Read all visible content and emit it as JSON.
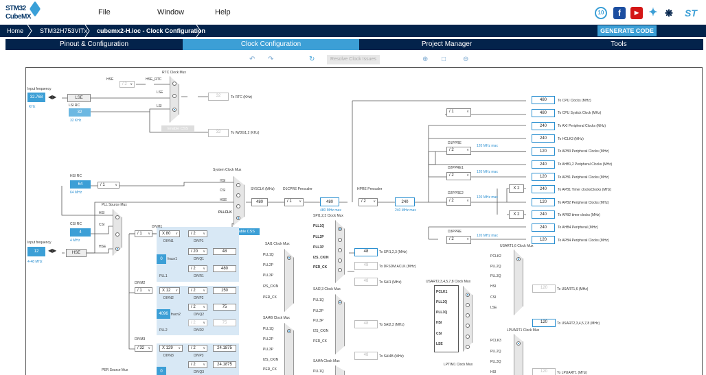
{
  "app": {
    "logo_line1": "STM32",
    "logo_line2": "CubeMX"
  },
  "menu": {
    "file": "File",
    "window": "Window",
    "help": "Help"
  },
  "breadcrumb": {
    "home": "Home",
    "device": "STM32H753VITx",
    "file": "cubemx2-H.ioc - Clock Configuration"
  },
  "actions": {
    "generate": "GENERATE CODE"
  },
  "tabs": {
    "pinout": "Pinout & Configuration",
    "clock": "Clock Configuration",
    "project": "Project Manager",
    "tools": "Tools"
  },
  "toolbar": {
    "resolve": "Resolve Clock Issues"
  },
  "colors": {
    "navy": "#03234b",
    "accent": "#3c9fd6"
  },
  "icons": [
    "undo-icon",
    "redo-icon",
    "refresh-icon",
    "zoom-in-icon",
    "fit-icon",
    "zoom-out-icon",
    "social-icon",
    "facebook-icon",
    "youtube-icon",
    "twitter-icon",
    "network-icon",
    "st-logo-icon"
  ],
  "clock": {
    "rtc_mux": "RTC Clock Mux",
    "hse": "HSE",
    "hse_rtc": "HSE_RTC",
    "lse": "LSE",
    "lsi": "LSI",
    "div2": "/ 2",
    "div1": "/ 1",
    "input_freq": "Input frequency",
    "lse_value": "32.768",
    "khz": "KHz",
    "lsi_rc": "LSI RC",
    "lsi_value": "32",
    "lsi_khz": "32 KHz",
    "rtc_val": "32",
    "to_rtc": "To RTC (KHz)",
    "enable_css": "Enable CSS",
    "iwdg_val": "32",
    "to_iwdg": "To IWDG1,2 (KHz)",
    "hsi_rc": "HSI RC",
    "hsi_value": "64",
    "hsi_mhz": "64 MHz",
    "csi_rc": "CSI RC",
    "csi_value": "4",
    "csi_mhz": "4 MHz",
    "hse_value": "12",
    "hse_range": "4-48 MHz",
    "pll_source_mux": "PLL Source Mux",
    "hsi": "HSI",
    "csi": "CSI",
    "system_clock_mux": "System Clock Mux",
    "pllclk": "PLLCLK",
    "sysclk_label": "SYSCLK (MHz)",
    "sysclk": "480",
    "d1cpre_label": "D1CPRE Prescaler",
    "d1cpre": "/ 1",
    "d1cpre_out": "480",
    "max480": "480 MHz max",
    "hpre_label": "HPRE Prescaler",
    "hpre": "/ 2",
    "hpre_out": "240",
    "max240": "240 MHz max",
    "divm1": "DIVM1",
    "divm1_val": "/ 1",
    "mult1": "X 80",
    "divp1_sel": "/ 2",
    "divp1": "DIVP1",
    "divn1": "DIVN1",
    "divq1_sel": "/ 20",
    "divq1_out": "48",
    "divq1": "DIVQ1",
    "fracn1": "fracn1",
    "frac1_val": "0",
    "divr1_sel": "/ 2",
    "divr1_out": "480",
    "divr1": "DIVR1",
    "pll1": "PLL1",
    "divm2": "DIVM2",
    "divm2_val": "/ 1",
    "mult2": "X 12",
    "divp2_sel": "/ 2",
    "divp2_out": "150",
    "divp2": "DIVP2",
    "divn2": "DIVN2",
    "divq2_sel": "/ 2",
    "divq2_out": "75",
    "divq2": "DIVQ2",
    "fracn2": "fracn2",
    "frac2_val": "4096",
    "divr2_sel": "/ 2",
    "divr2_out": "75",
    "divr2": "DIVR2",
    "pll2": "PLL2",
    "divm3": "DIVM3",
    "divm3_val": "/ 32",
    "mult3": "X 129",
    "divp3_sel": "/ 2",
    "divp3_out": "24.1875",
    "divp3": "DIVP3",
    "divn3": "DIVN3",
    "divq3_sel": "/ 2",
    "divq3_out": "24.1875",
    "divq3": "DIVQ3",
    "frac3_val": "0",
    "per_source_mux": "PER Source Mux",
    "spi123_mux": "SPI1,2,3 Clock Mux",
    "pll1q": "PLL1Q",
    "pll2p": "PLL2P",
    "pll3p": "PLL3P",
    "i2s_ckin": "I2S_CKIN",
    "per_ck": "PER_CK",
    "spi_out": "48",
    "to_spi": "To SPI1,2,3 (MHz)",
    "dfsdm_out": "48",
    "to_dfsdm": "To DFSDM ACLK (MHz)",
    "sai1_mux": "SAI1 Clock Mux",
    "sai1_out": "48",
    "to_sai1": "To SAI1 (MHz)",
    "sai23_mux": "SAI2,3 Clock Mux",
    "sai23_out": "48",
    "to_sai23": "To SAI2,3 (MHz)",
    "sai4b_mux": "SAI4B Clock Mux",
    "sai4b_out": "48",
    "to_sai4b": "To SAI4B (MHz)",
    "sai4a_mux": "SAI4A Clock Mux",
    "pll1q_l": "PLL1Q",
    "pll2p_l": "PLL2P",
    "pll3p_l": "PLL3P",
    "usart_mux": "USART2,3,4,5,7,8 Clock Mux",
    "pclk1": "PCLK1",
    "pll2q": "PLL2Q",
    "pll3q": "PLL3Q",
    "lse_l": "LSE",
    "usart_out": "120",
    "to_usart": "To USART2,3,4,5,7,8 (MHz)",
    "usart16_mux": "USART1,6 Clock Mux",
    "pclk2": "PCLK2",
    "usart16_out": "120",
    "to_usart16": "To USART1,6 (MHz)",
    "lpuart1_mux": "LPUART1 Clock Mux",
    "pclk3": "PCLK3",
    "lpuart_out": "120",
    "to_lpuart": "To LPUART1 (MHz)",
    "lptim1_mux": "LPTIM1 Clock Mux",
    "cpu_out": "480",
    "to_cpu": "To CPU Clocks (MHz)",
    "systick_div": "/ 1",
    "systick_out": "480",
    "to_systick": "To CPU Systick Clock (MHz)",
    "axi_out": "240",
    "to_axi": "To AXI Peripheral Clocks (MHz)",
    "hclk3_out": "240",
    "to_hclk3": "To HCLK3 (MHz)",
    "d1ppre": "D1PPRE",
    "d1ppre_sel": "/ 2",
    "max120": "120 MHz max",
    "apb3_out": "120",
    "to_apb3": "To APB3 Peripheral Clocks (MHz)",
    "ahb12_out": "240",
    "to_ahb12": "To AHB1,2 Peripheral Clocks (MHz)",
    "d2ppre1": "D2PPRE1",
    "d2ppre1_sel": "/ 2",
    "apb1_out": "120",
    "to_apb1": "To APB1 Peripheral Clocks (MHz)",
    "x2": "X 2",
    "apb1t_out": "240",
    "to_apb1t": "To APB1 Timer clocksClocks (MHz)",
    "d2ppre2": "D2PPRE2",
    "d2ppre2_sel": "/ 2",
    "apb2_out": "120",
    "to_apb2": "To APB2 Peripheral Clocks (MHz)",
    "apb2t_out": "240",
    "to_apb2t": "To APB2 timer clocks (MHz)",
    "ahb4_out": "240",
    "to_ahb4": "To AHB4 Peripheral (MHz)",
    "d3ppre": "D3PPRE",
    "d3ppre_sel": "/ 2",
    "apb4_out": "120",
    "to_apb4": "To APB4 Peripheral Clocks (MHz)"
  }
}
